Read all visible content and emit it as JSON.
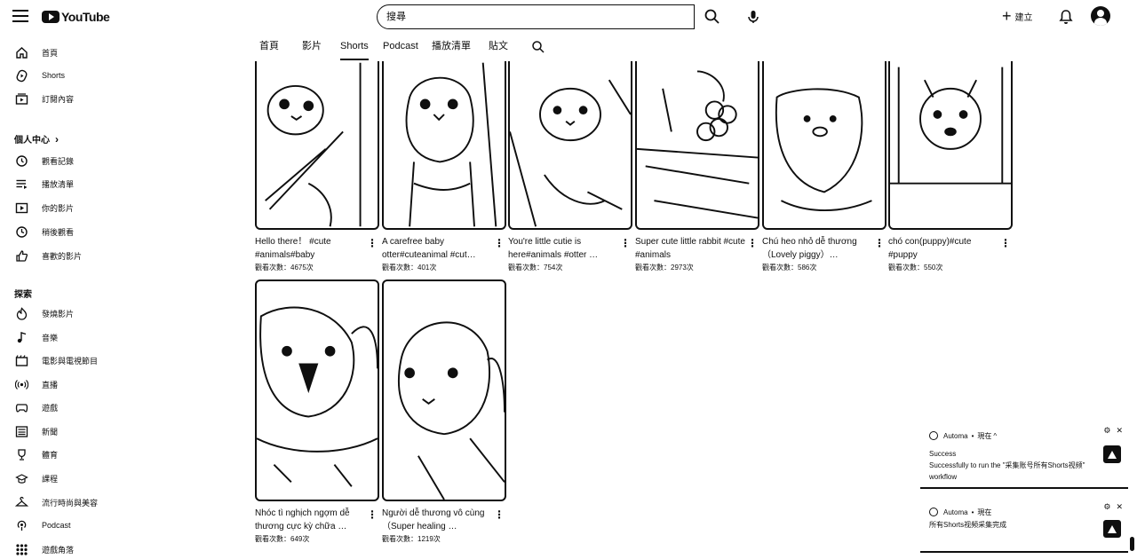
{
  "header": {
    "logo_text": "YouTube",
    "search_placeholder": "搜尋",
    "create_label": "建立"
  },
  "sidebar": {
    "main": [
      {
        "label": "首頁",
        "icon": "home-icon"
      },
      {
        "label": "Shorts",
        "icon": "shorts-icon"
      },
      {
        "label": "訂閱內容",
        "icon": "subscriptions-icon"
      }
    ],
    "you_heading": "個人中心",
    "you": [
      {
        "label": "觀看記錄",
        "icon": "history-icon"
      },
      {
        "label": "播放清單",
        "icon": "playlists-icon"
      },
      {
        "label": "你的影片",
        "icon": "your-videos-icon"
      },
      {
        "label": "稍後觀看",
        "icon": "watch-later-icon"
      },
      {
        "label": "喜歡的影片",
        "icon": "liked-icon"
      }
    ],
    "explore_heading": "探索",
    "explore": [
      {
        "label": "發燒影片",
        "icon": "trending-icon"
      },
      {
        "label": "音樂",
        "icon": "music-icon"
      },
      {
        "label": "電影與電視節目",
        "icon": "movies-icon"
      },
      {
        "label": "直播",
        "icon": "live-icon"
      },
      {
        "label": "遊戲",
        "icon": "gaming-icon"
      },
      {
        "label": "新聞",
        "icon": "news-icon"
      },
      {
        "label": "體育",
        "icon": "sports-icon"
      },
      {
        "label": "課程",
        "icon": "courses-icon"
      },
      {
        "label": "流行時尚與美容",
        "icon": "fashion-icon"
      },
      {
        "label": "Podcast",
        "icon": "podcast-icon"
      },
      {
        "label": "遊戲角落",
        "icon": "playables-icon"
      }
    ]
  },
  "tabs": [
    "首頁",
    "影片",
    "Shorts",
    "Podcast",
    "播放清單",
    "貼文"
  ],
  "active_tab": "Shorts",
  "shorts": [
    {
      "title": "Hello there！ #cute #animals#baby",
      "views": "觀看次數：4675次"
    },
    {
      "title": "A carefree baby otter#cuteanimal #cut…",
      "views": "觀看次數：401次"
    },
    {
      "title": "You're little cutie is here#animals #otter …",
      "views": "觀看次數：754次"
    },
    {
      "title": "Super cute little rabbit #cute #animals",
      "views": "觀看次數：2973次"
    },
    {
      "title": "Chú heo nhỏ dễ thương（Lovely piggy）…",
      "views": "觀看次數：586次"
    },
    {
      "title": "chó con(puppy)#cute #puppy",
      "views": "觀看次數：550次"
    },
    {
      "title": "Nhóc tì nghịch ngợm dễ thương cực kỳ chữa …",
      "views": "觀看次數：649次"
    },
    {
      "title": "Người dễ thương vô cùng（Super healing …",
      "views": "觀看次數：1219次"
    }
  ],
  "toasts": [
    {
      "source": "Automa",
      "time": "現在",
      "title": "Success",
      "message": "Successfully to run the \"采集账号所有Shorts视频\" workflow"
    },
    {
      "source": "Automa",
      "time": "現在",
      "message": "所有Shorts视频采集完成"
    }
  ]
}
